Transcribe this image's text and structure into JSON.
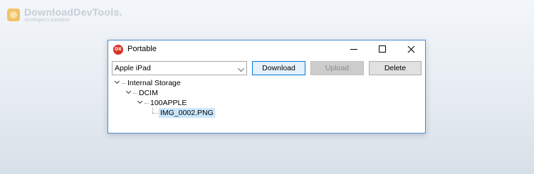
{
  "watermark": {
    "title": "DownloadDevTools.",
    "tagline": "developer's paradise"
  },
  "window": {
    "title": "Portable",
    "app_icon_text": "DX",
    "controls": [
      "minimize",
      "maximize",
      "close"
    ]
  },
  "toolbar": {
    "device_select": "Apple iPad",
    "download_label": "Download",
    "upload_label": "Upload",
    "delete_label": "Delete"
  },
  "tree": {
    "root": "Internal Storage",
    "level1": "DCIM",
    "level2": "100APPLE",
    "file": "IMG_0002.PNG"
  },
  "colors": {
    "accent": "#0078d7",
    "selection": "#cce8ff",
    "window_border": "#4a8fd6"
  }
}
